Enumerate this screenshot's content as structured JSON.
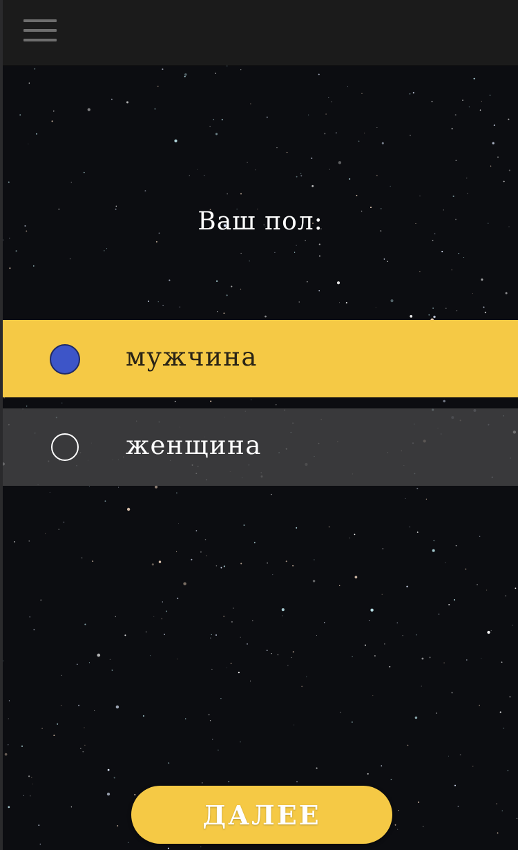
{
  "header": {
    "menu_icon": "hamburger-menu-icon"
  },
  "question": {
    "title": "Ваш пол:"
  },
  "options": [
    {
      "label": "мужчина",
      "selected": true
    },
    {
      "label": "женщина",
      "selected": false
    }
  ],
  "actions": {
    "next_label": "ДАЛЕЕ"
  },
  "colors": {
    "accent": "#f5c945",
    "radio_selected": "#3d55c8",
    "background": "#0c0d11",
    "topbar": "#1b1b1b"
  }
}
